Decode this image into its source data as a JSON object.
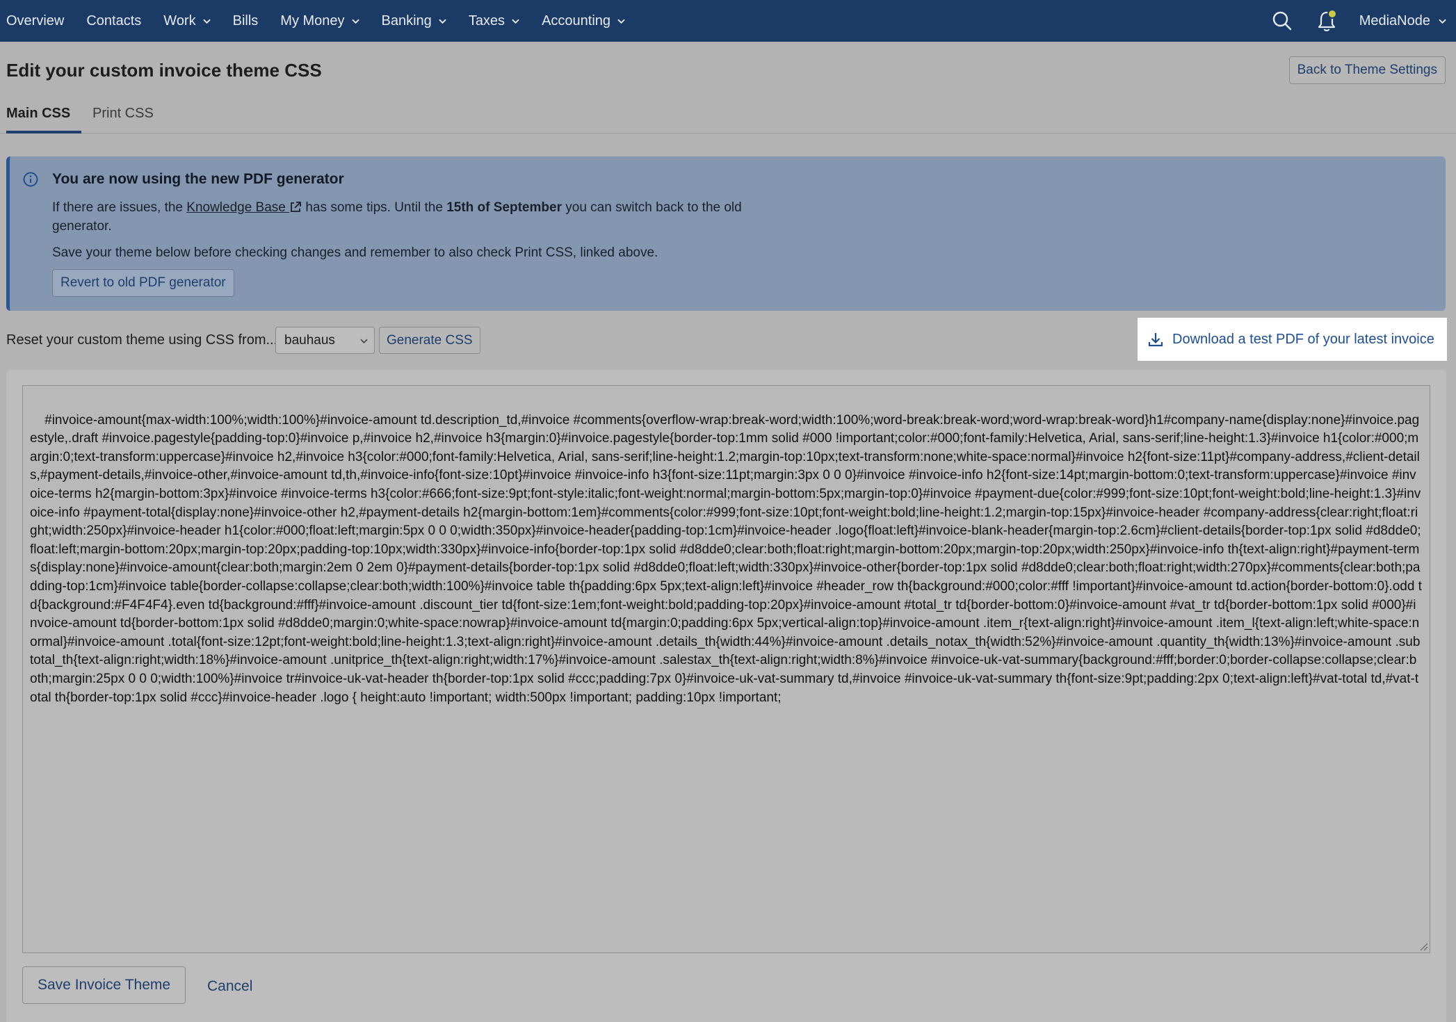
{
  "nav": {
    "items": [
      {
        "label": "Overview",
        "dropdown": false
      },
      {
        "label": "Contacts",
        "dropdown": false
      },
      {
        "label": "Work",
        "dropdown": true
      },
      {
        "label": "Bills",
        "dropdown": false
      },
      {
        "label": "My Money",
        "dropdown": true
      },
      {
        "label": "Banking",
        "dropdown": true
      },
      {
        "label": "Taxes",
        "dropdown": true
      },
      {
        "label": "Accounting",
        "dropdown": true
      }
    ],
    "account_name": "MediaNode",
    "icons": [
      "search-icon",
      "bell-icon"
    ]
  },
  "header": {
    "title": "Edit your custom invoice theme CSS",
    "back_button": "Back to Theme Settings"
  },
  "tabs": [
    {
      "label": "Main CSS",
      "active": true
    },
    {
      "label": "Print CSS",
      "active": false
    }
  ],
  "notice": {
    "title": "You are now using the new PDF generator",
    "text_before_link": "If there are issues, the ",
    "link_text": "Knowledge Base",
    "text_after_link": " has some tips. Until the ",
    "date_bold": "15th of September",
    "text_end": " you can switch back to the old generator.",
    "line2": "Save your theme below before checking changes and remember to also check Print CSS, linked above.",
    "revert_button": "Revert to old PDF generator"
  },
  "reset": {
    "label": "Reset your custom theme using CSS from...",
    "selected_theme": "bauhaus",
    "generate_button": "Generate CSS"
  },
  "download_button": "Download a test PDF of your latest invoice",
  "editor": {
    "css": "#invoice-amount{max-width:100%;width:100%}#invoice-amount td.description_td,#invoice #comments{overflow-wrap:break-word;width:100%;word-break:break-word;word-wrap:break-word}h1#company-name{display:none}#invoice.pagestyle,.draft #invoice.pagestyle{padding-top:0}#invoice p,#invoice h2,#invoice h3{margin:0}#invoice.pagestyle{border-top:1mm solid #000 !important;color:#000;font-family:Helvetica, Arial, sans-serif;line-height:1.3}#invoice h1{color:#000;margin:0;text-transform:uppercase}#invoice h2,#invoice h3{color:#000;font-family:Helvetica, Arial, sans-serif;line-height:1.2;margin-top:10px;text-transform:none;white-space:normal}#invoice h2{font-size:11pt}#company-address,#client-details,#payment-details,#invoice-other,#invoice-amount td,th,#invoice-info{font-size:10pt}#invoice #invoice-info h3{font-size:11pt;margin:3px 0 0 0}#invoice #invoice-info h2{font-size:14pt;margin-bottom:0;text-transform:uppercase}#invoice #invoice-terms h2{margin-bottom:3px}#invoice #invoice-terms h3{color:#666;font-size:9pt;font-style:italic;font-weight:normal;margin-bottom:5px;margin-top:0}#invoice #payment-due{color:#999;font-size:10pt;font-weight:bold;line-height:1.3}#invoice-info #payment-total{display:none}#invoice-other h2,#payment-details h2{margin-bottom:1em}#comments{color:#999;font-size:10pt;font-weight:bold;line-height:1.2;margin-top:15px}#invoice-header #company-address{clear:right;float:right;width:250px}#invoice-header h1{color:#000;float:left;margin:5px 0 0 0;width:350px}#invoice-header{padding-top:1cm}#invoice-header .logo{float:left}#invoice-blank-header{margin-top:2.6cm}#client-details{border-top:1px solid #d8dde0;float:left;margin-bottom:20px;margin-top:20px;padding-top:10px;width:330px}#invoice-info{border-top:1px solid #d8dde0;clear:both;float:right;margin-bottom:20px;margin-top:20px;width:250px}#invoice-info th{text-align:right}#payment-terms{display:none}#invoice-amount{clear:both;margin:2em 0 2em 0}#payment-details{border-top:1px solid #d8dde0;float:left;width:330px}#invoice-other{border-top:1px solid #d8dde0;clear:both;float:right;width:270px}#comments{clear:both;padding-top:1cm}#invoice table{border-collapse:collapse;clear:both;width:100%}#invoice table th{padding:6px 5px;text-align:left}#invoice #header_row th{background:#000;color:#fff !important}#invoice-amount td.action{border-bottom:0}.odd td{background:#F4F4F4}.even td{background:#fff}#invoice-amount .discount_tier td{font-size:1em;font-weight:bold;padding-top:20px}#invoice-amount #total_tr td{border-bottom:0}#invoice-amount #vat_tr td{border-bottom:1px solid #000}#invoice-amount td{border-bottom:1px solid #d8dde0;margin:0;white-space:nowrap}#invoice-amount td{margin:0;padding:6px 5px;vertical-align:top}#invoice-amount .item_r{text-align:right}#invoice-amount .item_l{text-align:left;white-space:normal}#invoice-amount .total{font-size:12pt;font-weight:bold;line-height:1.3;text-align:right}#invoice-amount .details_th{width:44%}#invoice-amount .details_notax_th{width:52%}#invoice-amount .quantity_th{width:13%}#invoice-amount .subtotal_th{text-align:right;width:18%}#invoice-amount .unitprice_th{text-align:right;width:17%}#invoice-amount .salestax_th{text-align:right;width:8%}#invoice #invoice-uk-vat-summary{background:#fff;border:0;border-collapse:collapse;clear:both;margin:25px 0 0 0;width:100%}#invoice tr#invoice-uk-vat-header th{border-top:1px solid #ccc;padding:7px 0}#invoice-uk-vat-summary td,#invoice #invoice-uk-vat-summary th{font-size:9pt;padding:2px 0;text-align:left}#vat-total td,#vat-total th{border-top:1px solid #ccc}#invoice-header .logo { height:auto !important; width:500px !important; padding:10px !important;",
    "save_button": "Save Invoice Theme",
    "cancel_link": "Cancel"
  },
  "colors": {
    "nav_bg": "#1c3a66",
    "accent": "#1f3d6d",
    "notice_bg": "#8597b0",
    "page_bg": "#b3b3b3"
  }
}
